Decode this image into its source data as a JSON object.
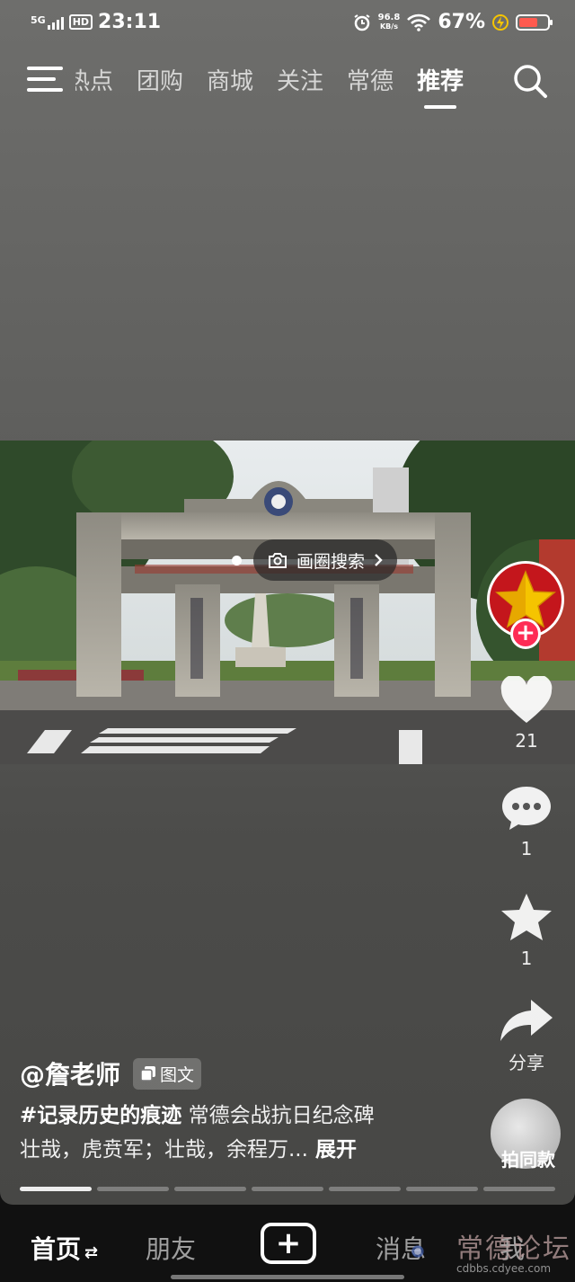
{
  "status_bar": {
    "network": "5G",
    "hd": "HD",
    "time": "23:11",
    "speed_value": "96.8",
    "speed_unit": "KB/s",
    "battery_pct": "67%",
    "battery_level": 0.67
  },
  "top_tabs": [
    {
      "label": "热点",
      "partial": true
    },
    {
      "label": "团购"
    },
    {
      "label": "商城"
    },
    {
      "label": "关注"
    },
    {
      "label": "常德"
    },
    {
      "label": "推荐",
      "active": true
    }
  ],
  "image_search": {
    "label": "画圈搜索"
  },
  "actions": {
    "like_count": "21",
    "comment_count": "1",
    "favorite_count": "1",
    "share_label": "分享",
    "same_style_label": "拍同款"
  },
  "post": {
    "author": "@詹老师",
    "type_badge": "图文",
    "hashtag": "#记录历史的痕迹",
    "text_line1_rest": " 常德会战抗日纪念碑",
    "text_line2": "壮哉，虎贲军；壮哉，余程万...",
    "expand_label": " 展开",
    "image_count": 7,
    "current_image": 1
  },
  "bottom_nav": {
    "home": "首页",
    "friends": "朋友",
    "messages": "消息",
    "me": "我"
  },
  "watermark": {
    "text": "常德论坛",
    "url": "cdbbs.cdyee.com"
  },
  "colors": {
    "accent": "#fe2c55",
    "avatar_bg": "#c4161c",
    "star": "#f5c400",
    "battery": "#ff5a4f"
  }
}
